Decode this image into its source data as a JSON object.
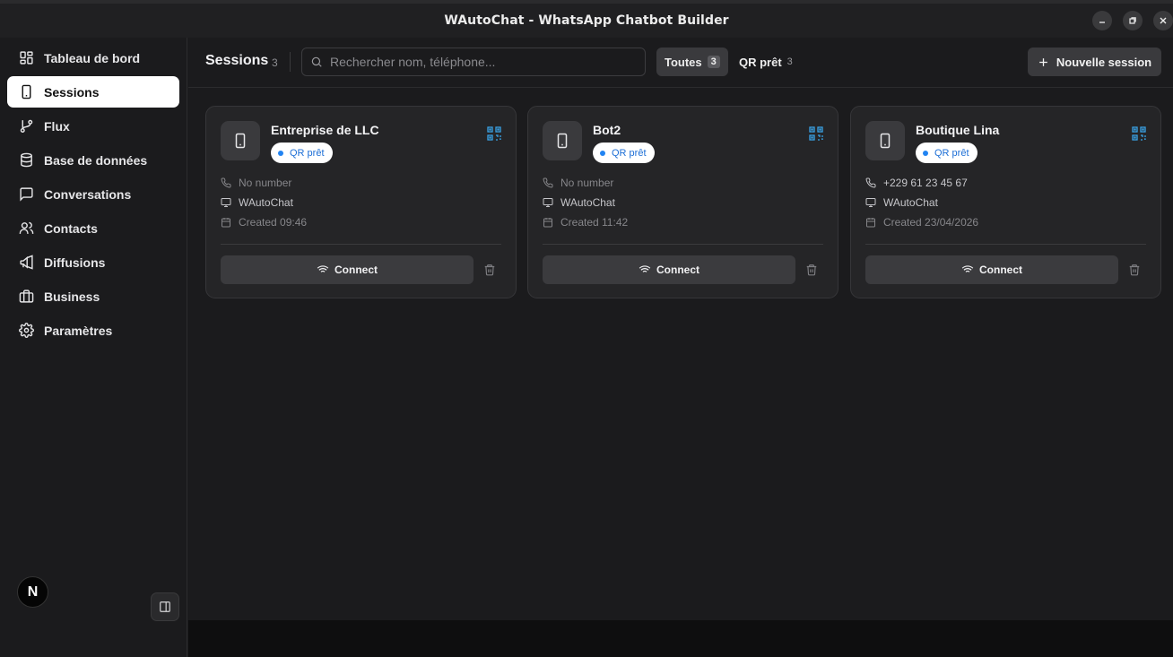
{
  "window": {
    "title": "WAutoChat - WhatsApp Chatbot Builder"
  },
  "sidebar": {
    "items": [
      {
        "label": "Tableau de bord",
        "icon": "dashboard-icon"
      },
      {
        "label": "Sessions",
        "icon": "smartphone-icon",
        "active": true
      },
      {
        "label": "Flux",
        "icon": "git-branch-icon"
      },
      {
        "label": "Base de données",
        "icon": "database-icon"
      },
      {
        "label": "Conversations",
        "icon": "message-square-icon"
      },
      {
        "label": "Contacts",
        "icon": "users-icon"
      },
      {
        "label": "Diffusions",
        "icon": "megaphone-icon"
      },
      {
        "label": "Business",
        "icon": "briefcase-icon"
      },
      {
        "label": "Paramètres",
        "icon": "settings-icon"
      }
    ],
    "avatar_letter": "N"
  },
  "header": {
    "title": "Sessions",
    "count": "3",
    "search_placeholder": "Rechercher nom, téléphone...",
    "filters": [
      {
        "label": "Toutes",
        "count": "3",
        "active": true
      },
      {
        "label": "QR prêt",
        "count": "3",
        "active": false
      }
    ],
    "new_session_label": "Nouvelle session"
  },
  "sessions": [
    {
      "name": "Entreprise de LLC",
      "status": "QR prêt",
      "phone": "No number",
      "source": "WAutoChat",
      "created": "Created 09:46",
      "action": "Connect"
    },
    {
      "name": "Bot2",
      "status": "QR prêt",
      "phone": "No number",
      "source": "WAutoChat",
      "created": "Created 11:42",
      "action": "Connect"
    },
    {
      "name": "Boutique Lina",
      "status": "QR prêt",
      "phone": "+229 61 23 45 67",
      "source": "WAutoChat",
      "created": "Created 23/04/2026",
      "action": "Connect"
    }
  ],
  "colors": {
    "accent": "#2284f2",
    "qr_icon": "#3aa3e6",
    "active_nav_bg": "#ffffff"
  }
}
